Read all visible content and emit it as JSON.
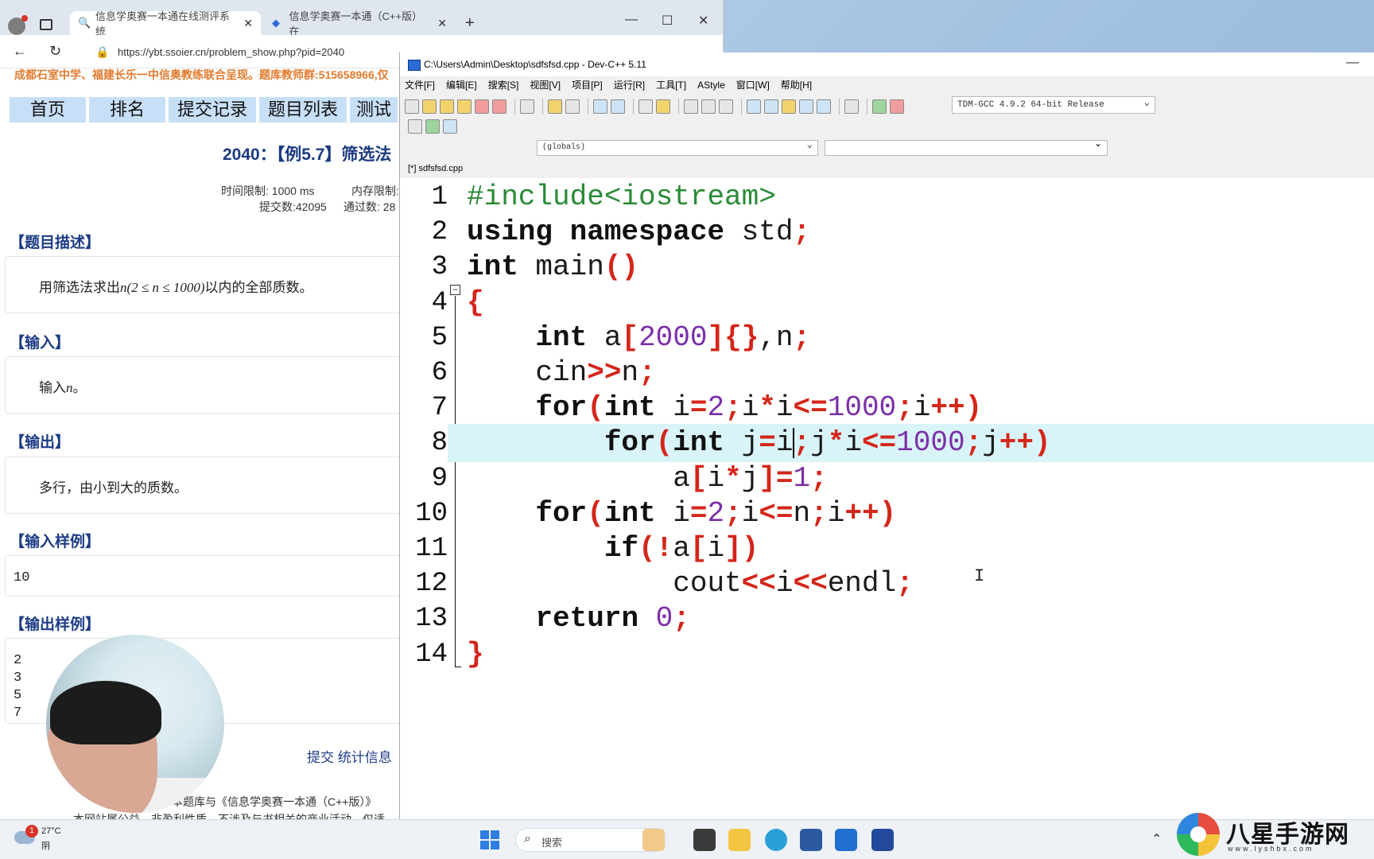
{
  "browser": {
    "tabs": [
      {
        "label": "信息学奥赛一本通在线测评系统"
      },
      {
        "label": "信息学奥赛一本通（C++版）在"
      }
    ],
    "url": "https://ybt.ssoier.cn/problem_show.php?pid=2040"
  },
  "page": {
    "notice": "成都石室中学、福建长乐一中信奥教练联合呈现。题库教师群:515658966,仅",
    "nav": [
      "首页",
      "排名",
      "提交记录",
      "题目列表",
      "测试"
    ],
    "title": "2040：【例5.7】筛选法",
    "time_limit": "时间限制: 1000 ms",
    "memory_limit": "内存限制:",
    "submissions": "提交数:42095",
    "accepted": "通过数: 28",
    "sections": {
      "description_h": "【题目描述】",
      "description_pre": "用筛选法求出",
      "description_math": "n(2 ≤ n ≤ 1000)",
      "description_post": "以内的全部质数。",
      "input_h": "【输入】",
      "input_pre": "输入",
      "input_math": "n",
      "input_post": "。",
      "output_h": "【输出】",
      "output_text": "多行，由小到大的质数。",
      "sample_in_h": "【输入样例】",
      "sample_in": "10",
      "sample_out_h": "【输出样例】",
      "sample_out": [
        "2",
        "3",
        "5",
        "7"
      ]
    },
    "links": "提交  统计信息",
    "footer1": "本题库与《信息学奥赛一本通（C++版）》",
    "footer2": "本网站属公益，非盈利性质，不涉及与书相关的商业活动，仅适"
  },
  "devcpp": {
    "title": "C:\\Users\\Admin\\Desktop\\sdfsfsd.cpp - Dev-C++ 5.11",
    "menu": [
      "文件[F]",
      "编辑[E]",
      "搜索[S]",
      "视图[V]",
      "项目[P]",
      "运行[R]",
      "工具[T]",
      "AStyle",
      "窗口[W]",
      "帮助[H]"
    ],
    "compiler": "TDM-GCC 4.9.2 64-bit Release",
    "scope": "(globals)",
    "file_tab": "[*] sdfsfsd.cpp",
    "current_line": 8,
    "colors": {
      "keyword": "#111111",
      "symbol": "#d4261a",
      "number": "#7b2fa8",
      "preprocessor": "#2a8a36",
      "highlight": "#d9f4f8"
    },
    "lines": [
      {
        "n": "1"
      },
      {
        "n": "2"
      },
      {
        "n": "3"
      },
      {
        "n": "4"
      },
      {
        "n": "5"
      },
      {
        "n": "6"
      },
      {
        "n": "7"
      },
      {
        "n": "8"
      },
      {
        "n": "9"
      },
      {
        "n": "10"
      },
      {
        "n": "11"
      },
      {
        "n": "12"
      },
      {
        "n": "13"
      },
      {
        "n": "14"
      }
    ]
  },
  "taskbar": {
    "badge": "1",
    "temp": "27°C",
    "cond": "阴",
    "search": "搜索"
  },
  "watermark": {
    "text": "八星手游网",
    "url": "www.lyshbx.com"
  }
}
